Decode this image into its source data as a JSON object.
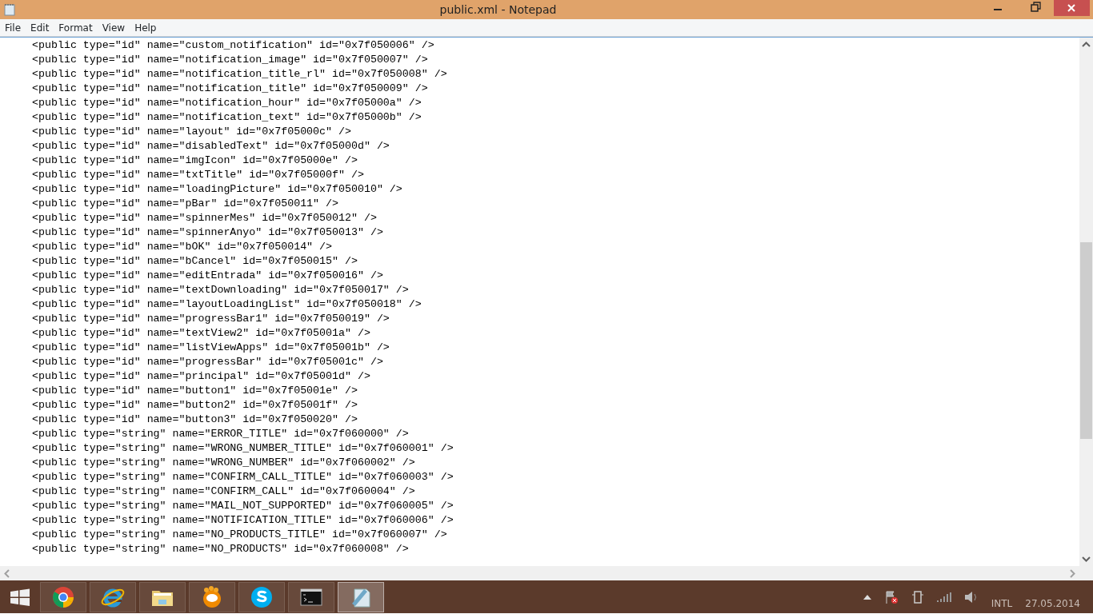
{
  "window": {
    "title": "public.xml - Notepad"
  },
  "menu": [
    {
      "label": "File"
    },
    {
      "label": "Edit"
    },
    {
      "label": "Format"
    },
    {
      "label": "View"
    },
    {
      "label": "Help"
    }
  ],
  "editor": {
    "lines": [
      "<public type=\"id\" name=\"custom_notification\" id=\"0x7f050006\" />",
      "<public type=\"id\" name=\"notification_image\" id=\"0x7f050007\" />",
      "<public type=\"id\" name=\"notification_title_rl\" id=\"0x7f050008\" />",
      "<public type=\"id\" name=\"notification_title\" id=\"0x7f050009\" />",
      "<public type=\"id\" name=\"notification_hour\" id=\"0x7f05000a\" />",
      "<public type=\"id\" name=\"notification_text\" id=\"0x7f05000b\" />",
      "<public type=\"id\" name=\"layout\" id=\"0x7f05000c\" />",
      "<public type=\"id\" name=\"disabledText\" id=\"0x7f05000d\" />",
      "<public type=\"id\" name=\"imgIcon\" id=\"0x7f05000e\" />",
      "<public type=\"id\" name=\"txtTitle\" id=\"0x7f05000f\" />",
      "<public type=\"id\" name=\"loadingPicture\" id=\"0x7f050010\" />",
      "<public type=\"id\" name=\"pBar\" id=\"0x7f050011\" />",
      "<public type=\"id\" name=\"spinnerMes\" id=\"0x7f050012\" />",
      "<public type=\"id\" name=\"spinnerAnyo\" id=\"0x7f050013\" />",
      "<public type=\"id\" name=\"bOK\" id=\"0x7f050014\" />",
      "<public type=\"id\" name=\"bCancel\" id=\"0x7f050015\" />",
      "<public type=\"id\" name=\"editEntrada\" id=\"0x7f050016\" />",
      "<public type=\"id\" name=\"textDownloading\" id=\"0x7f050017\" />",
      "<public type=\"id\" name=\"layoutLoadingList\" id=\"0x7f050018\" />",
      "<public type=\"id\" name=\"progressBar1\" id=\"0x7f050019\" />",
      "<public type=\"id\" name=\"textView2\" id=\"0x7f05001a\" />",
      "<public type=\"id\" name=\"listViewApps\" id=\"0x7f05001b\" />",
      "<public type=\"id\" name=\"progressBar\" id=\"0x7f05001c\" />",
      "<public type=\"id\" name=\"principal\" id=\"0x7f05001d\" />",
      "<public type=\"id\" name=\"button1\" id=\"0x7f05001e\" />",
      "<public type=\"id\" name=\"button2\" id=\"0x7f05001f\" />",
      "<public type=\"id\" name=\"button3\" id=\"0x7f050020\" />",
      "<public type=\"string\" name=\"ERROR_TITLE\" id=\"0x7f060000\" />",
      "<public type=\"string\" name=\"WRONG_NUMBER_TITLE\" id=\"0x7f060001\" />",
      "<public type=\"string\" name=\"WRONG_NUMBER\" id=\"0x7f060002\" />",
      "<public type=\"string\" name=\"CONFIRM_CALL_TITLE\" id=\"0x7f060003\" />",
      "<public type=\"string\" name=\"CONFIRM_CALL\" id=\"0x7f060004\" />",
      "<public type=\"string\" name=\"MAIL_NOT_SUPPORTED\" id=\"0x7f060005\" />",
      "<public type=\"string\" name=\"NOTIFICATION_TITLE\" id=\"0x7f060006\" />",
      "<public type=\"string\" name=\"NO_PRODUCTS_TITLE\" id=\"0x7f060007\" />",
      "<public type=\"string\" name=\"NO_PRODUCTS\" id=\"0x7f060008\" />"
    ]
  },
  "taskbar": {
    "apps": [
      {
        "kind": "chrome",
        "selected": false
      },
      {
        "kind": "ie",
        "selected": false
      },
      {
        "kind": "explorer",
        "selected": false
      },
      {
        "kind": "player",
        "selected": false
      },
      {
        "kind": "skype",
        "selected": false
      },
      {
        "kind": "cmd",
        "selected": false
      },
      {
        "kind": "notepad",
        "selected": true
      }
    ]
  },
  "tray": {
    "language": "INTL",
    "date": "27.05.2014"
  }
}
